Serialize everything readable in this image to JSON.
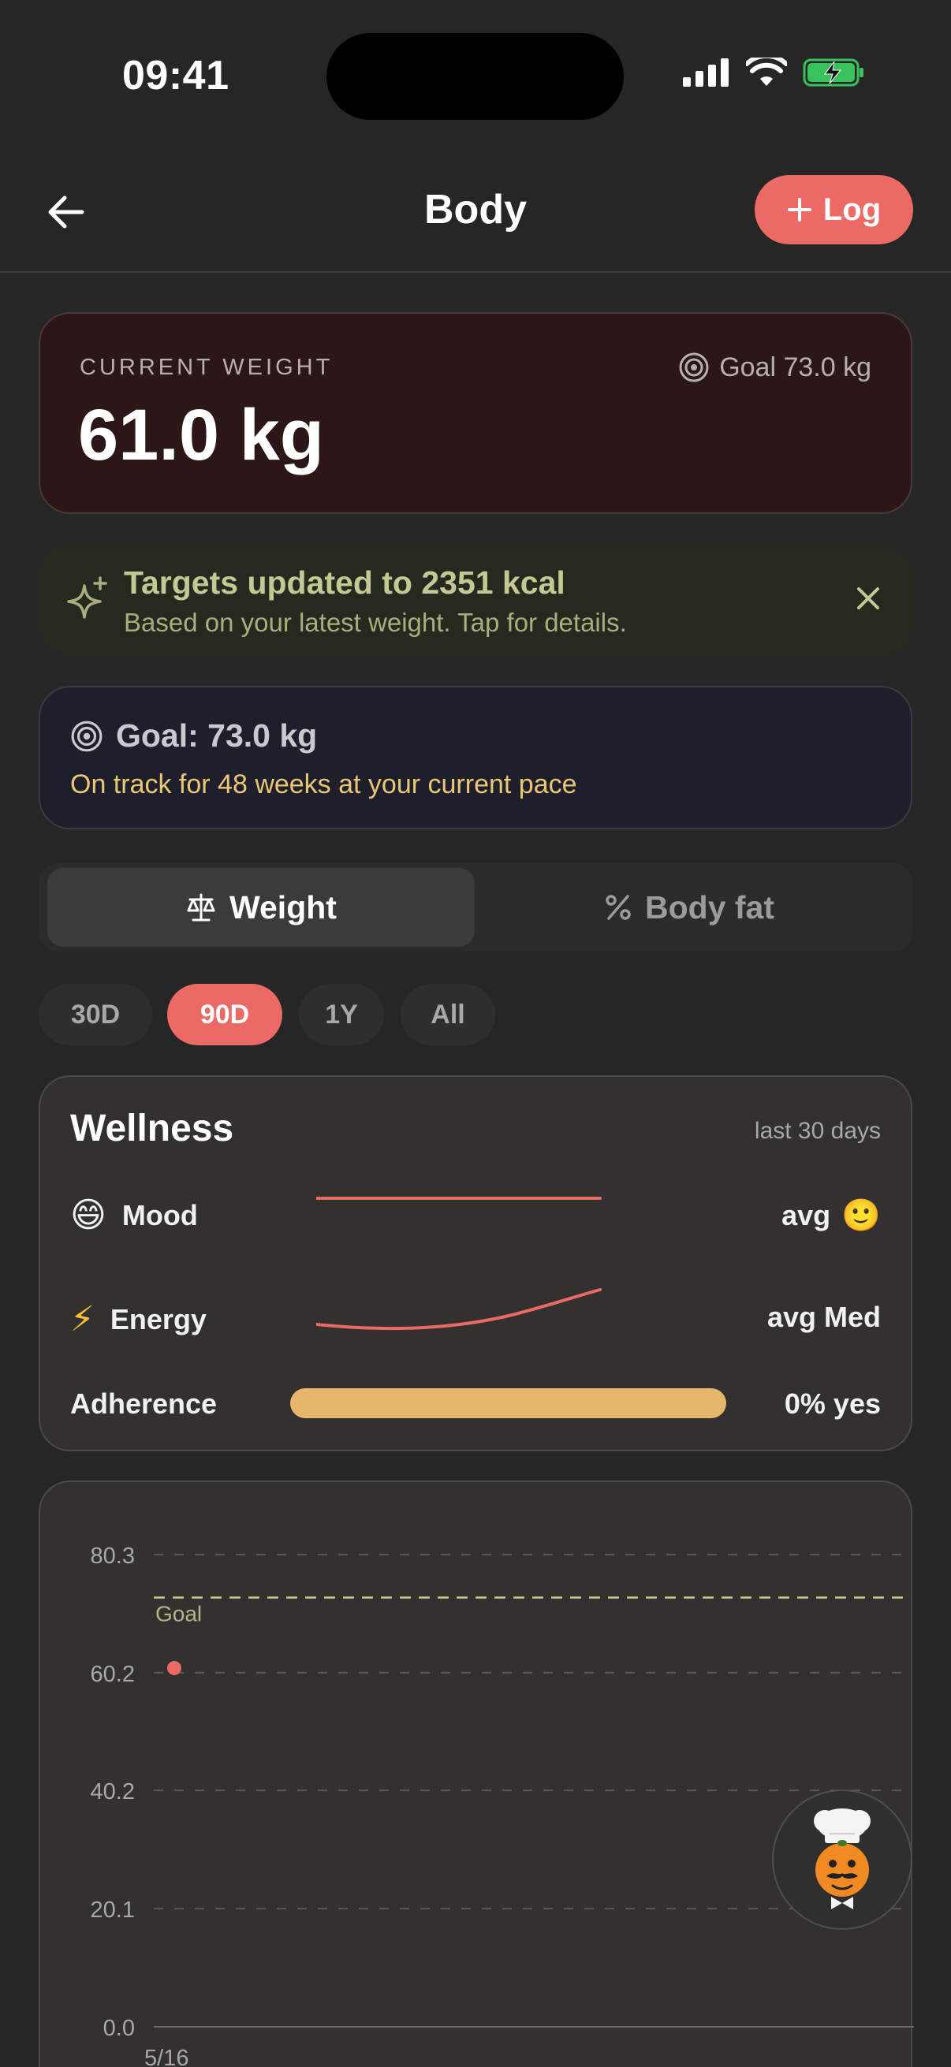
{
  "status": {
    "time": "09:41"
  },
  "header": {
    "title": "Body",
    "log_label": "Log"
  },
  "current_weight": {
    "label": "CURRENT WEIGHT",
    "value": "61.0 kg",
    "goal": "Goal 73.0 kg"
  },
  "targets_banner": {
    "title": "Targets updated to 2351 kcal",
    "subtitle": "Based on your latest weight. Tap for details."
  },
  "goal_card": {
    "title": "Goal: 73.0 kg",
    "subtitle": "On track for 48 weeks at your current pace"
  },
  "metric_tabs": [
    {
      "label": "Weight",
      "icon": "scale-icon",
      "selected": true
    },
    {
      "label": "Body fat",
      "icon": "percent-icon",
      "selected": false
    }
  ],
  "ranges": [
    "30D",
    "90D",
    "1Y",
    "All"
  ],
  "selected_range": "90D",
  "wellness": {
    "title": "Wellness",
    "period": "last 30 days",
    "mood": {
      "emoji": "😄",
      "label": "Mood",
      "summary": "avg",
      "summary_emoji": "🙂"
    },
    "energy": {
      "emoji": "⚡",
      "label": "Energy",
      "summary": "avg Med"
    },
    "adherence": {
      "label": "Adherence",
      "summary": "0% yes",
      "value_fraction": 0.0
    }
  },
  "colors": {
    "accent": "#ec6a65",
    "goal_line": "#c9c98a",
    "adherence": "#e6b66a",
    "goal_text": "#e8c877"
  },
  "chart_data": {
    "type": "scatter",
    "y_ticks": [
      "80.3",
      "60.2",
      "40.2",
      "20.1",
      "0.0"
    ],
    "ylim": [
      0,
      80.3
    ],
    "goal": {
      "label": "Goal",
      "value": 73.0
    },
    "x_tick_labels": [
      "5/16"
    ],
    "points": [
      {
        "x": "5/16",
        "y": 61.0
      }
    ],
    "grid": true
  }
}
